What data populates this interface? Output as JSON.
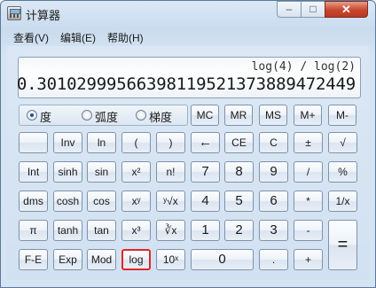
{
  "window": {
    "title": "计算器",
    "controls": {
      "minimize": "–",
      "maximize": "□",
      "close": "✕"
    }
  },
  "menu": [
    "查看(V)",
    "编辑(E)",
    "帮助(H)"
  ],
  "display": {
    "expression": "log(4) / log(2)",
    "result": "0.301029995663981195213738894724 49"
  },
  "angle_units": [
    {
      "label": "度",
      "checked": true
    },
    {
      "label": "弧度",
      "checked": false
    },
    {
      "label": "梯度",
      "checked": false
    }
  ],
  "memory_buttons": [
    "MC",
    "MR",
    "MS",
    "M+",
    "M-"
  ],
  "buttons": {
    "row2": [
      "",
      "Inv",
      "ln",
      "(",
      ")",
      "←",
      "CE",
      "C",
      "±",
      "√"
    ],
    "row3": [
      "Int",
      "sinh",
      "sin",
      "x²",
      "n!",
      "7",
      "8",
      "9",
      "/",
      "%"
    ],
    "row4": [
      "dms",
      "cosh",
      "cos",
      "xʸ",
      "ʸ√x",
      "4",
      "5",
      "6",
      "*",
      "1/x"
    ],
    "row5": [
      "π",
      "tanh",
      "tan",
      "x³",
      "∛x",
      "1",
      "2",
      "3",
      "-",
      "="
    ],
    "row6": [
      "F-E",
      "Exp",
      "Mod",
      "log",
      "10ˣ",
      "0",
      ".",
      "+"
    ]
  },
  "highlighted_button": "log"
}
